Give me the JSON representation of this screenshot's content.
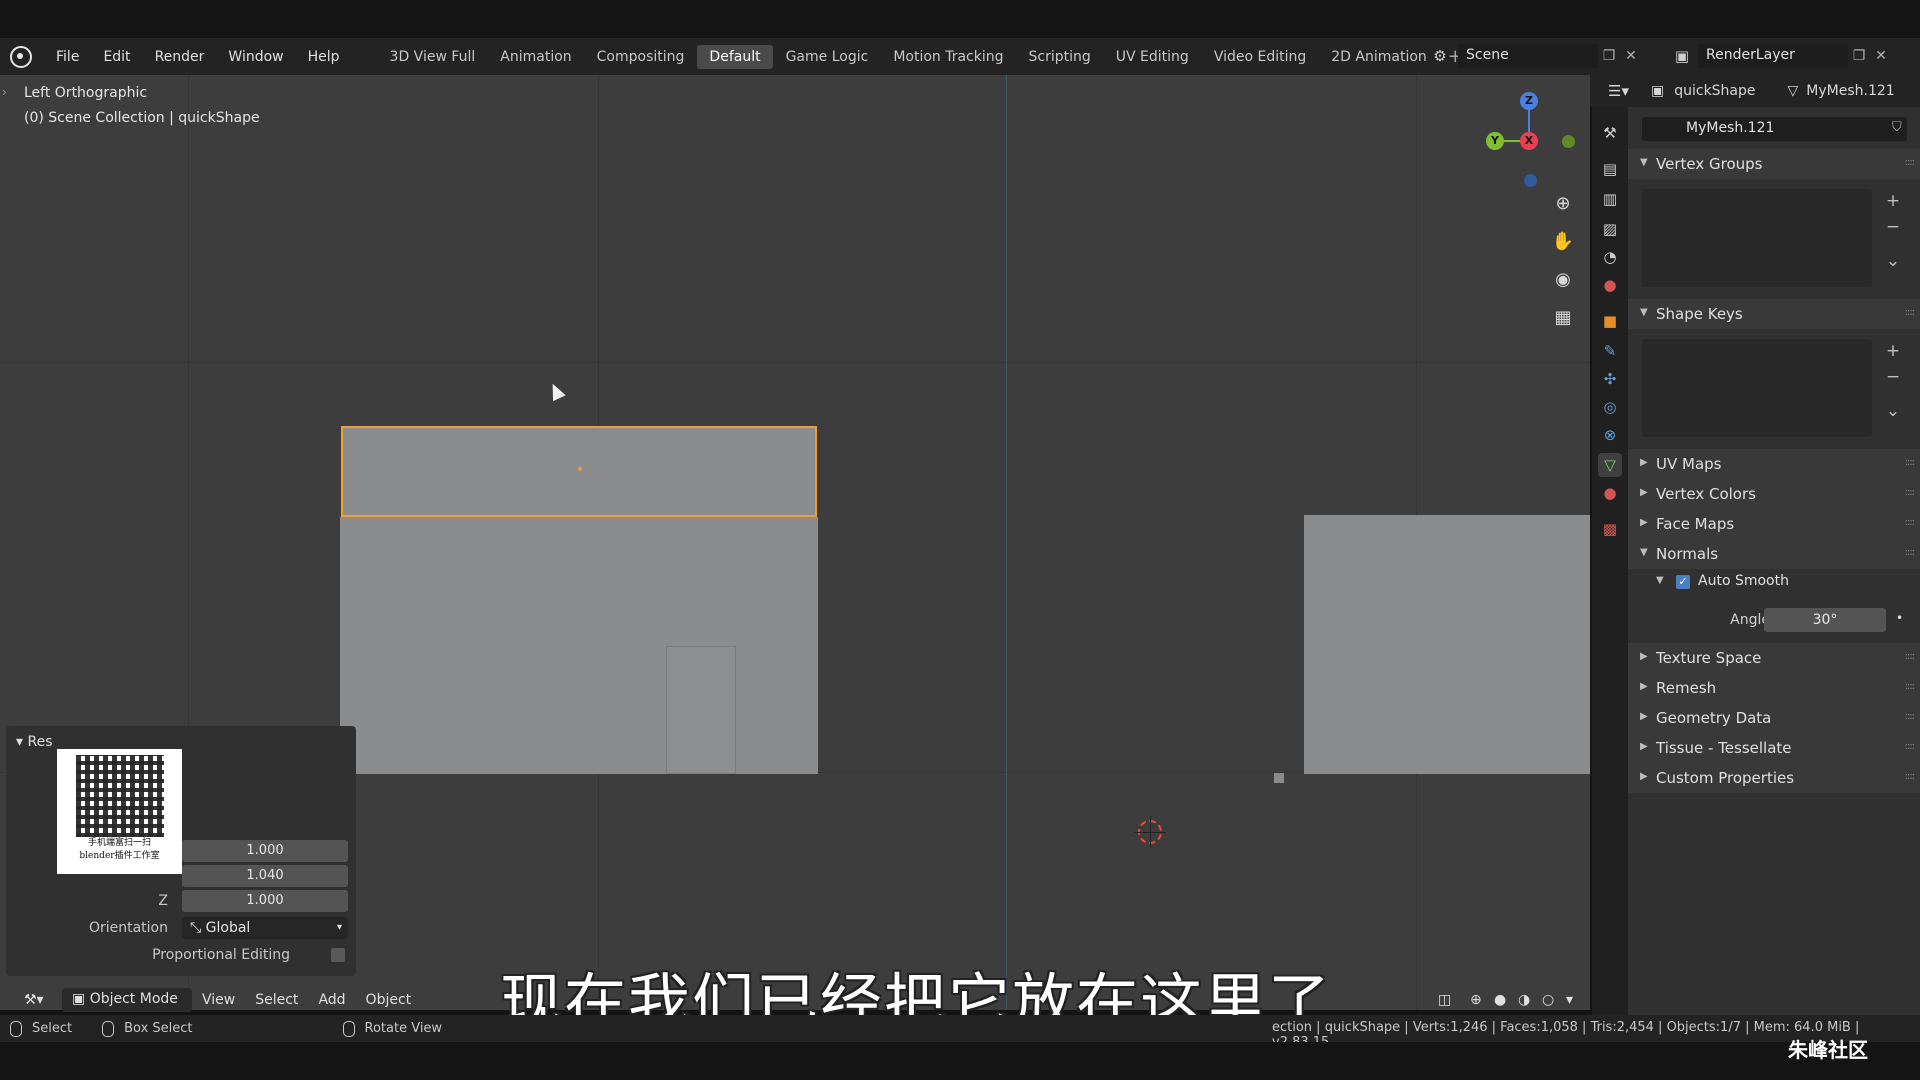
{
  "topbar": {
    "menu": [
      "File",
      "Edit",
      "Render",
      "Window",
      "Help"
    ],
    "workspaces": [
      "3D View Full",
      "Animation",
      "Compositing",
      "Default",
      "Game Logic",
      "Motion Tracking",
      "Scripting",
      "UV Editing",
      "Video Editing",
      "2D Animation"
    ],
    "active_workspace": "Default",
    "scene": "Scene",
    "render_layer": "RenderLayer"
  },
  "viewport": {
    "view_name": "Left Orthographic",
    "collection_info": "(0) Scene Collection | quickShape",
    "gizmo": {
      "x": "X",
      "y": "Y",
      "z": "Z"
    }
  },
  "redo_panel": {
    "title": "Res",
    "values": {
      "x": "1.000",
      "y": "1.040",
      "z": "1.000"
    },
    "z_label": "Z",
    "orientation_label": "Orientation",
    "orientation_value": "Global",
    "proportional_label": "Proportional Editing"
  },
  "qr_caption": {
    "line1": "手机端富扫一扫",
    "line2": "blender插件工作室"
  },
  "viewport_header": {
    "mode": "Object Mode",
    "menus": [
      "View",
      "Select",
      "Add",
      "Object"
    ]
  },
  "subtitle": "现在我们已经把它放在这里了",
  "properties": {
    "object_name": "quickShape",
    "mesh_name_header": "MyMesh.121",
    "mesh_field": "MyMesh.121",
    "panels": {
      "vertex_groups": "Vertex Groups",
      "shape_keys": "Shape Keys",
      "uv_maps": "UV Maps",
      "vertex_colors": "Vertex Colors",
      "face_maps": "Face Maps",
      "normals": "Normals",
      "auto_smooth": "Auto Smooth",
      "angle_label": "Angle",
      "angle_value": "30°",
      "texture_space": "Texture Space",
      "remesh": "Remesh",
      "geometry_data": "Geometry Data",
      "tissue": "Tissue - Tessellate",
      "custom_props": "Custom Properties"
    }
  },
  "statusbar": {
    "select": "Select",
    "box_select": "Box Select",
    "rotate": "Rotate View",
    "stats": "ection | quickShape | Verts:1,246 | Faces:1,058 | Tris:2,454 | Objects:1/7 | Mem: 64.0 MiB | v2.83.15"
  },
  "watermark": "朱峰社区",
  "colors": {
    "selection": "#f29c38",
    "accent_blue": "#4a7fc1"
  }
}
